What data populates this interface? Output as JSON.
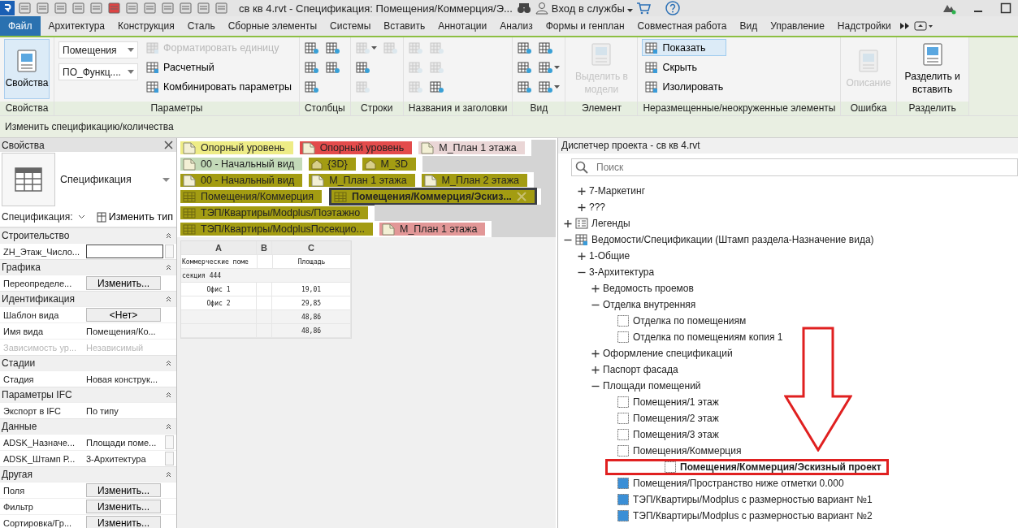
{
  "title_bar": {
    "title": "св кв 4.rvt - Спецификация: Помещения/Коммерция/Э...",
    "sign_in": "Вход в службы"
  },
  "ribbon_tabs": [
    {
      "label": "Файл",
      "selected": true
    },
    {
      "label": "Архитектура",
      "selected": false
    },
    {
      "label": "Конструкция",
      "selected": false
    },
    {
      "label": "Сталь",
      "selected": false
    },
    {
      "label": "Сборные элементы",
      "selected": false
    },
    {
      "label": "Системы",
      "selected": false
    },
    {
      "label": "Вставить",
      "selected": false
    },
    {
      "label": "Аннотации",
      "selected": false
    },
    {
      "label": "Анализ",
      "selected": false
    },
    {
      "label": "Формы и генплан",
      "selected": false
    },
    {
      "label": "Совместная работа",
      "selected": false
    },
    {
      "label": "Вид",
      "selected": false
    },
    {
      "label": "Управление",
      "selected": false
    },
    {
      "label": "Надстройки",
      "selected": false
    }
  ],
  "ribbon_panels": [
    {
      "label": "Свойства",
      "columns": [
        {
          "items": [
            {
              "kind": "large",
              "label": "Свойства",
              "active": true,
              "disabled": false
            }
          ]
        }
      ]
    },
    {
      "label": "Параметры",
      "columns": [
        {
          "items": [
            {
              "kind": "dropdown",
              "value": "Помещения"
            },
            {
              "kind": "dropdown",
              "value": "ПО_Функц...."
            }
          ]
        },
        {
          "items": [
            {
              "kind": "small",
              "label": "Форматировать единицу",
              "active": false,
              "disabled": true
            },
            {
              "kind": "small",
              "label": "Расчетный",
              "active": false,
              "disabled": false
            },
            {
              "kind": "small",
              "label": "Комбинировать параметры",
              "active": false,
              "disabled": false
            }
          ]
        }
      ]
    },
    {
      "label": "Столбцы",
      "columns": [
        {
          "items": [
            {
              "kind": "icon",
              "disabled": false
            },
            {
              "kind": "icon",
              "disabled": false
            },
            {
              "kind": "icon",
              "disabled": false
            }
          ]
        },
        {
          "items": [
            {
              "kind": "icon",
              "disabled": false
            },
            {
              "kind": "icon",
              "disabled": false
            }
          ]
        }
      ]
    },
    {
      "label": "Строки",
      "columns": [
        {
          "items": [
            {
              "kind": "icon",
              "disabled": true,
              "caret": true
            },
            {
              "kind": "icon",
              "disabled": false
            },
            {
              "kind": "icon",
              "disabled": true
            }
          ]
        },
        {
          "items": [
            {
              "kind": "icon",
              "disabled": true
            }
          ]
        }
      ]
    },
    {
      "label": "Названия и заголовки",
      "columns": [
        {
          "items": [
            {
              "kind": "icon",
              "disabled": true
            },
            {
              "kind": "icon",
              "disabled": true
            },
            {
              "kind": "icon",
              "disabled": true
            }
          ]
        },
        {
          "items": [
            {
              "kind": "icon",
              "disabled": true
            },
            {
              "kind": "icon",
              "disabled": true
            },
            {
              "kind": "icon",
              "disabled": false
            }
          ]
        }
      ]
    },
    {
      "label": "Вид",
      "columns": [
        {
          "items": [
            {
              "kind": "icon",
              "disabled": false
            },
            {
              "kind": "icon",
              "disabled": false
            },
            {
              "kind": "icon",
              "disabled": false
            }
          ]
        },
        {
          "items": [
            {
              "kind": "icon",
              "disabled": false
            },
            {
              "kind": "icon",
              "disabled": false,
              "caret": true
            },
            {
              "kind": "icon",
              "disabled": false,
              "caret": true
            }
          ]
        }
      ]
    },
    {
      "label": "Элемент",
      "columns": [
        {
          "items": [
            {
              "kind": "large",
              "label": "Выделить в модели",
              "active": false,
              "disabled": true
            }
          ]
        }
      ]
    },
    {
      "label": "Неразмещенные/неокруженные элементы",
      "columns": [
        {
          "items": [
            {
              "kind": "small",
              "label": "Показать",
              "active": true,
              "disabled": false
            },
            {
              "kind": "small",
              "label": "Скрыть",
              "active": false,
              "disabled": false
            },
            {
              "kind": "small",
              "label": "Изолировать",
              "active": false,
              "disabled": false
            }
          ]
        }
      ]
    },
    {
      "label": "Ошибка",
      "columns": [
        {
          "items": [
            {
              "kind": "large",
              "label": "Описание",
              "active": false,
              "disabled": true
            }
          ]
        }
      ]
    },
    {
      "label": "Разделить",
      "columns": [
        {
          "items": [
            {
              "kind": "large",
              "label": "Разделить и вставить",
              "active": false,
              "disabled": false
            }
          ]
        }
      ]
    }
  ],
  "context_label": "Изменить спецификацию/количества",
  "properties": {
    "title": "Свойства",
    "type_name": "Спецификация",
    "selector": "Спецификация:",
    "edit_type": "Изменить тип",
    "groups": [
      {
        "label": "Строительство",
        "rows": [
          {
            "name": "ZH_Этаж_Число...",
            "kind": "input",
            "value": "",
            "disabled": false
          }
        ]
      },
      {
        "label": "Графика",
        "rows": [
          {
            "name": "Переопределе...",
            "kind": "button",
            "value": "Изменить...",
            "disabled": false
          }
        ]
      },
      {
        "label": "Идентификация",
        "rows": [
          {
            "name": "Шаблон вида",
            "kind": "button",
            "value": "<Нет>",
            "disabled": false
          },
          {
            "name": "Имя вида",
            "kind": "text",
            "value": "Помещения/Ко...",
            "disabled": false
          },
          {
            "name": "Зависимость ур...",
            "kind": "text",
            "value": "Независимый",
            "disabled": true
          }
        ]
      },
      {
        "label": "Стадии",
        "rows": [
          {
            "name": "Стадия",
            "kind": "text",
            "value": "Новая конструк...",
            "disabled": false
          }
        ]
      },
      {
        "label": "Параметры IFC",
        "rows": [
          {
            "name": "Экспорт в IFC",
            "kind": "text",
            "value": "По типу",
            "disabled": false
          }
        ]
      },
      {
        "label": "Данные",
        "rows": [
          {
            "name": "ADSK_Назначе...",
            "kind": "boxed",
            "value": "Площади поме...",
            "disabled": false
          },
          {
            "name": "ADSK_Штамп Р...",
            "kind": "boxed",
            "value": "3-Архитектура",
            "disabled": false
          }
        ]
      },
      {
        "label": "Другая",
        "rows": [
          {
            "name": "Поля",
            "kind": "button",
            "value": "Изменить...",
            "disabled": false
          },
          {
            "name": "Фильтр",
            "kind": "button",
            "value": "Изменить...",
            "disabled": false
          },
          {
            "name": "Сортировка/Гр...",
            "kind": "button",
            "value": "Изменить...",
            "disabled": false
          }
        ]
      }
    ]
  },
  "view_tabs": [
    {
      "tabs": [
        {
          "label": "Опорный уровень",
          "kind": "plan",
          "color": "#eeec86",
          "selected": false
        },
        {
          "label": "Опорный уровень",
          "kind": "plan",
          "color": "#e34b4b",
          "selected": false
        },
        {
          "label": "М_План 1 этажа",
          "kind": "plan",
          "color": "#ead6d6",
          "selected": false
        }
      ]
    },
    {
      "tabs": [
        {
          "label": "00 - Начальный вид",
          "kind": "plan",
          "color": "#c3dab8",
          "selected": false
        },
        {
          "label": "{3D}",
          "kind": "model",
          "color": "#a39c12",
          "selected": false
        },
        {
          "label": "М_3D",
          "kind": "model",
          "color": "#a39c12",
          "selected": false
        }
      ]
    },
    {
      "tabs": [
        {
          "label": "00 - Начальный вид",
          "kind": "plan",
          "color": "#a39c12",
          "selected": false
        },
        {
          "label": "М_План 1 этажа",
          "kind": "plan",
          "color": "#a39c12",
          "selected": false
        },
        {
          "label": "М_План 2 этажа",
          "kind": "plan",
          "color": "#a39c12",
          "selected": false
        }
      ]
    },
    {
      "tabs": [
        {
          "label": "Помещения/Коммерция",
          "kind": "schedule",
          "color": "#a39c12",
          "selected": false
        },
        {
          "label": "Помещения/Коммерция/Эскиз...",
          "kind": "schedule",
          "color": "#a39c12",
          "selected": true
        }
      ]
    },
    {
      "tabs": [
        {
          "label": "ТЭП/Квартиры/Modplus/Поэтажно",
          "kind": "schedule",
          "color": "#a39c12",
          "selected": false
        }
      ]
    },
    {
      "tabs": [
        {
          "label": "ТЭП/Квартиры/ModplusПосекцио...",
          "kind": "schedule",
          "color": "#a39c12",
          "selected": false
        },
        {
          "label": "М_План 1 этажа",
          "kind": "plan",
          "color": "#e29797",
          "selected": false
        }
      ]
    }
  ],
  "schedule": {
    "columns": [
      "A",
      "B",
      "C"
    ],
    "rows": [
      {
        "kind": "header",
        "cells": [
          "Коммерческие поме",
          "",
          "Площадь"
        ]
      },
      {
        "kind": "group",
        "cells": [
          "секция 444"
        ]
      },
      {
        "kind": "data",
        "cells": [
          "Офис 1",
          "",
          "19,01"
        ]
      },
      {
        "kind": "data",
        "cells": [
          "Офис 2",
          "",
          "29,85"
        ]
      },
      {
        "kind": "total",
        "cells": [
          "",
          "",
          "48,86"
        ]
      },
      {
        "kind": "total",
        "cells": [
          "",
          "",
          "48,86"
        ]
      }
    ]
  },
  "project_browser": {
    "title": "Диспетчер проекта - св кв 4.rvt",
    "search": {
      "placeholder": "Поиск"
    },
    "continued": [
      {
        "label": "7-Маркетинг",
        "expanded": false
      },
      {
        "label": "???",
        "expanded": false
      }
    ],
    "items": [
      {
        "label": "Легенды",
        "kind": "legend",
        "expanded": false
      },
      {
        "label": "Ведомости/Спецификации (Штамп раздела-Назначение вида)",
        "kind": "schedules",
        "expanded": true,
        "children": [
          {
            "label": "1-Общие",
            "expanded": false
          },
          {
            "label": "3-Архитектура",
            "expanded": true,
            "children": [
              {
                "label": "Ведомость проемов",
                "expanded": false
              },
              {
                "label": "Отделка внутренняя",
                "expanded": true,
                "children": [
                  {
                    "label": "Отделка по помещениям",
                    "kind": "unplaced",
                    "current": false,
                    "highlighted": false
                  },
                  {
                    "label": "Отделка по помещениям копия 1",
                    "kind": "unplaced",
                    "current": false,
                    "highlighted": false
                  }
                ]
              },
              {
                "label": "Оформление спецификаций",
                "expanded": false
              },
              {
                "label": "Паспорт фасада",
                "expanded": false
              },
              {
                "label": "Площади помещений",
                "expanded": true,
                "children": [
                  {
                    "label": "Помещения/1 этаж",
                    "kind": "unplaced",
                    "current": false,
                    "highlighted": false
                  },
                  {
                    "label": "Помещения/2 этаж",
                    "kind": "unplaced",
                    "current": false,
                    "highlighted": false
                  },
                  {
                    "label": "Помещения/3 этаж",
                    "kind": "unplaced",
                    "current": false,
                    "highlighted": false
                  },
                  {
                    "label": "Помещения/Коммерция",
                    "kind": "unplaced",
                    "current": false,
                    "highlighted": false
                  },
                  {
                    "label": "Помещения/Коммерция/Эскизный проект",
                    "kind": "unplaced",
                    "current": true,
                    "highlighted": true
                  },
                  {
                    "label": "Помещения/Пространство ниже отметки 0.000",
                    "kind": "placed",
                    "current": false,
                    "highlighted": false
                  },
                  {
                    "label": "ТЭП/Квартиры/Modplus с размерностью вариант №1",
                    "kind": "placed",
                    "current": false,
                    "highlighted": false
                  },
                  {
                    "label": "ТЭП/Квартиры/Modplus с размерностью вариант №2",
                    "kind": "placed",
                    "current": false,
                    "highlighted": false
                  }
                ]
              }
            ]
          }
        ]
      }
    ]
  }
}
